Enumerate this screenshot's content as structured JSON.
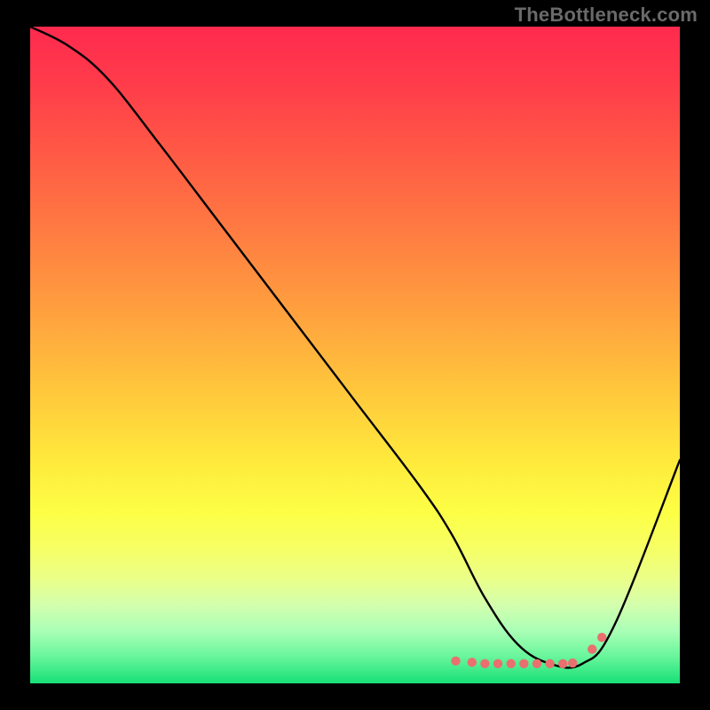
{
  "watermark": "TheBottleneck.com",
  "chart_data": {
    "type": "line",
    "title": "",
    "xlabel": "",
    "ylabel": "",
    "xlim": [
      0,
      100
    ],
    "ylim": [
      0,
      100
    ],
    "grid": false,
    "series": [
      {
        "name": "curve",
        "x": [
          0,
          6,
          12,
          20,
          30,
          40,
          50,
          60,
          65,
          70,
          75,
          80,
          85,
          90,
          100
        ],
        "values": [
          100,
          97,
          92,
          82,
          69,
          56,
          43,
          30,
          22.5,
          13,
          6,
          3,
          3,
          9,
          34
        ]
      }
    ],
    "markers": {
      "name": "highlight",
      "color": "#e9706f",
      "x": [
        65.5,
        68,
        70,
        72,
        74,
        76,
        78,
        80,
        82,
        83.5,
        86.5,
        88
      ],
      "values": [
        3.4,
        3.2,
        3.0,
        3.0,
        3.0,
        3.0,
        3.0,
        3.0,
        3.0,
        3.1,
        5.2,
        7.0
      ]
    },
    "background_gradient": {
      "type": "vertical",
      "stops": [
        {
          "pos": 0,
          "color": "#ff2a4e"
        },
        {
          "pos": 50,
          "color": "#ffc93c"
        },
        {
          "pos": 80,
          "color": "#f8ff5a"
        },
        {
          "pos": 100,
          "color": "#17e077"
        }
      ]
    }
  }
}
